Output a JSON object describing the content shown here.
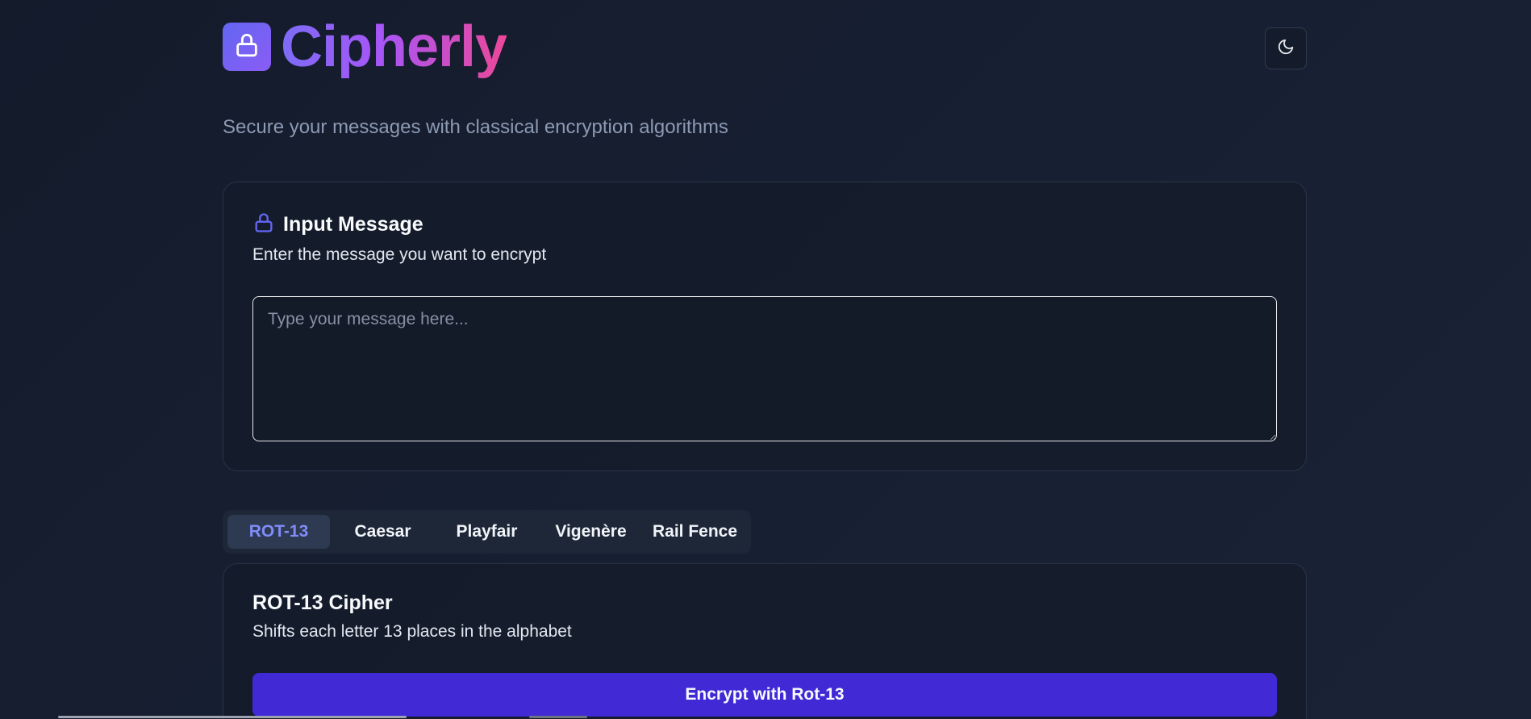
{
  "app": {
    "brand": "Cipherly",
    "tagline": "Secure your messages with classical encryption algorithms",
    "icons": {
      "logo": "lock-icon",
      "theme_toggle": "moon-icon",
      "input_title": "lock-icon"
    },
    "colors": {
      "accent": "#6366f1",
      "brand_gradient_start": "#7c6cf6",
      "brand_gradient_end": "#ec4899",
      "button": "#4229d6"
    }
  },
  "input_card": {
    "title": "Input Message",
    "description": "Enter the message you want to encrypt",
    "value": "",
    "placeholder": "Type your message here..."
  },
  "tabs": {
    "items": [
      {
        "label": "ROT-13",
        "active": true
      },
      {
        "label": "Caesar",
        "active": false
      },
      {
        "label": "Playfair",
        "active": false
      },
      {
        "label": "Vigenère",
        "active": false
      },
      {
        "label": "Rail Fence",
        "active": false
      }
    ]
  },
  "cipher_card": {
    "title": "ROT-13 Cipher",
    "description": "Shifts each letter 13 places in the alphabet",
    "button_label": "Encrypt with Rot-13"
  }
}
